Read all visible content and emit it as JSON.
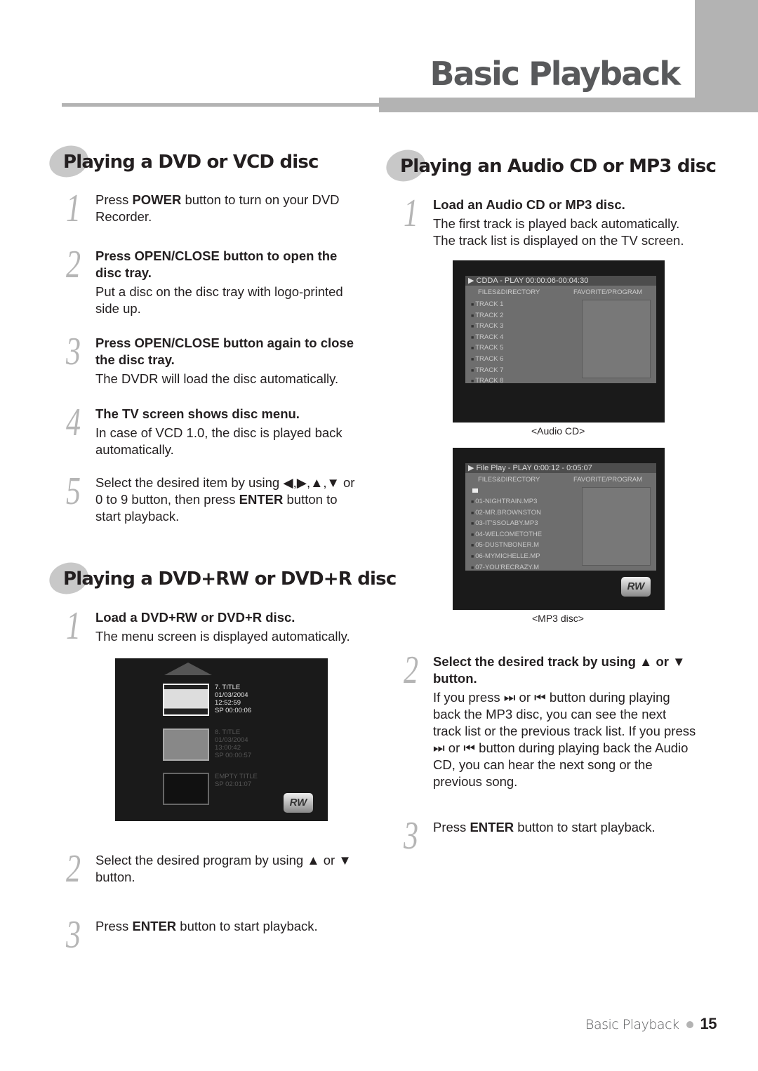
{
  "header": {
    "title": "Basic Playback"
  },
  "sections": {
    "dvd_vcd": {
      "title": "Playing a DVD or VCD disc",
      "steps": [
        {
          "num": "1",
          "pre": "Press ",
          "bold": "POWER",
          "post": " button to turn on your DVD Recorder."
        },
        {
          "num": "2",
          "heading": "Press OPEN/CLOSE button to open the disc tray.",
          "body": "Put a disc on the disc tray with logo-printed side up."
        },
        {
          "num": "3",
          "heading": "Press OPEN/CLOSE button again to close the disc tray.",
          "body": "The DVDR will load the disc automatically."
        },
        {
          "num": "4",
          "heading": "The TV screen shows disc menu.",
          "body": "In case of VCD 1.0, the disc is played back automatically."
        },
        {
          "num": "5",
          "pre": "Select the desired item by using ◀,▶,▲,▼ or 0 to 9 button, then press ",
          "bold": "ENTER",
          "post": " button to start playback."
        }
      ]
    },
    "dvd_rw": {
      "title": "Playing a DVD+RW or DVD+R disc",
      "steps": [
        {
          "num": "1",
          "heading": "Load a DVD+RW or DVD+R disc.",
          "body": "The menu screen is displayed automatically."
        },
        {
          "num": "2",
          "text": "Select the desired program by using ▲ or ▼ button."
        },
        {
          "num": "3",
          "pre": "Press ",
          "bold": "ENTER",
          "post": " button to start playback."
        }
      ],
      "screen": {
        "titles": [
          {
            "info": "7. TITLE\n01/03/2004\n12:52:59\nSP 00:00:06",
            "selected": true
          },
          {
            "info": "8. TITLE\n01/03/2004\n13:00:42\nSP 00:00:57",
            "selected": false
          },
          {
            "info": "EMPTY TITLE\nSP 02:01:07",
            "selected": false
          }
        ],
        "badge": "RW"
      }
    },
    "audio_mp3": {
      "title": "Playing an Audio CD or MP3 disc",
      "steps": [
        {
          "num": "1",
          "heading": "Load an Audio CD or MP3 disc.",
          "body": "The first track is played back automatically. The track list is displayed on the TV screen."
        },
        {
          "num": "2",
          "heading": "Select the desired track by using ▲ or ▼ button.",
          "body": "If you press ⏭ or ⏮ button during playing back the MP3 disc, you can see the next track list or the previous track list. If you press ⏭ or ⏮ button during playing back the Audio CD, you can hear the next song or the previous song."
        },
        {
          "num": "3",
          "pre": "Press ",
          "bold": "ENTER",
          "post": " button to start playback."
        }
      ],
      "audio_cd_screen": {
        "status": "▶ CDDA  - PLAY   00:00:06-00:04:30",
        "left_header": "FILES&DIRECTORY",
        "right_header": "FAVORITE/PROGRAM",
        "tracks": [
          "TRACK 1",
          "TRACK 2",
          "TRACK 3",
          "TRACK 4",
          "TRACK 5",
          "TRACK 6",
          "TRACK 7",
          "TRACK 8"
        ],
        "caption": "<Audio CD>"
      },
      "mp3_screen": {
        "status": "▶ File Play - PLAY    0:00:12 -  0:05:07",
        "left_header": "FILES&DIRECTORY",
        "right_header": "FAVORITE/PROGRAM",
        "tracks": [
          "01-NIGHTRAIN.MP3",
          "02-MR.BROWNSTON",
          "03-IT'SSOLABY.MP3",
          "04-WELCOMETOTHE",
          "05-DUSTNBONER.M",
          "06-MYMICHELLE.MP",
          "07-YOU'RECRAZY.M"
        ],
        "badge": "RW",
        "caption": "<MP3 disc>"
      }
    }
  },
  "footer": {
    "section": "Basic Playback",
    "page": "15"
  }
}
